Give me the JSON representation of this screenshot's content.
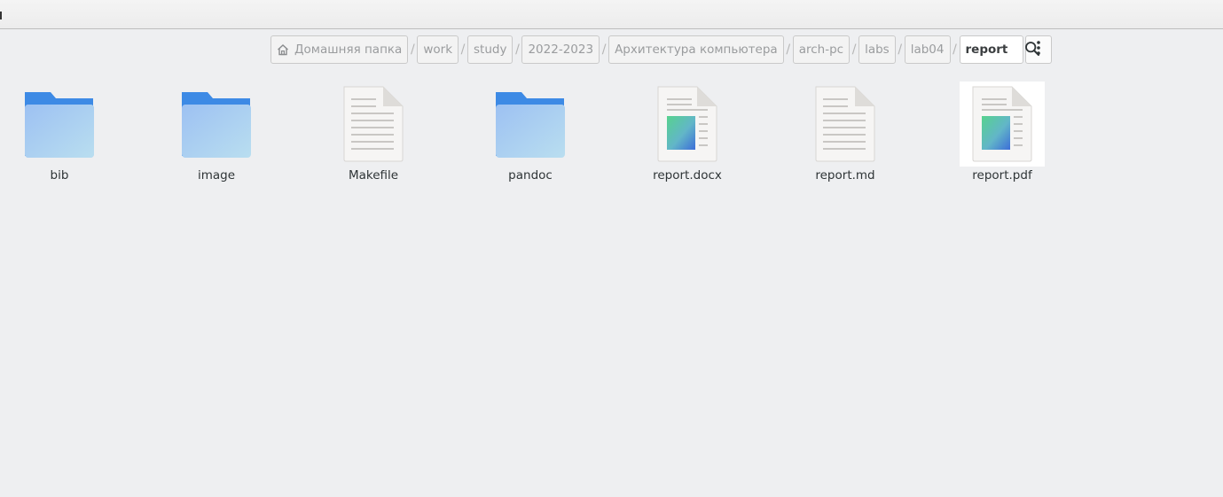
{
  "breadcrumbs": {
    "items": [
      "Домашняя папка",
      "work",
      "study",
      "2022-2023",
      "Архитектура компьютера",
      "arch-pc",
      "labs",
      "lab04"
    ],
    "current": "report",
    "separator": "/"
  },
  "toolbar": {
    "menu_icon": "vertical-dots-icon",
    "search_icon": "search-icon"
  },
  "files": [
    {
      "name": "bib",
      "type": "folder"
    },
    {
      "name": "image",
      "type": "folder"
    },
    {
      "name": "Makefile",
      "type": "text"
    },
    {
      "name": "pandoc",
      "type": "folder"
    },
    {
      "name": "report.docx",
      "type": "document-image"
    },
    {
      "name": "report.md",
      "type": "text"
    },
    {
      "name": "report.pdf",
      "type": "document-image",
      "selected": true
    }
  ],
  "colors": {
    "folder_back": "#3d8ae5",
    "folder_front": "#9cc3f3",
    "selection": "#ffffff",
    "background": "#eeeff1"
  }
}
